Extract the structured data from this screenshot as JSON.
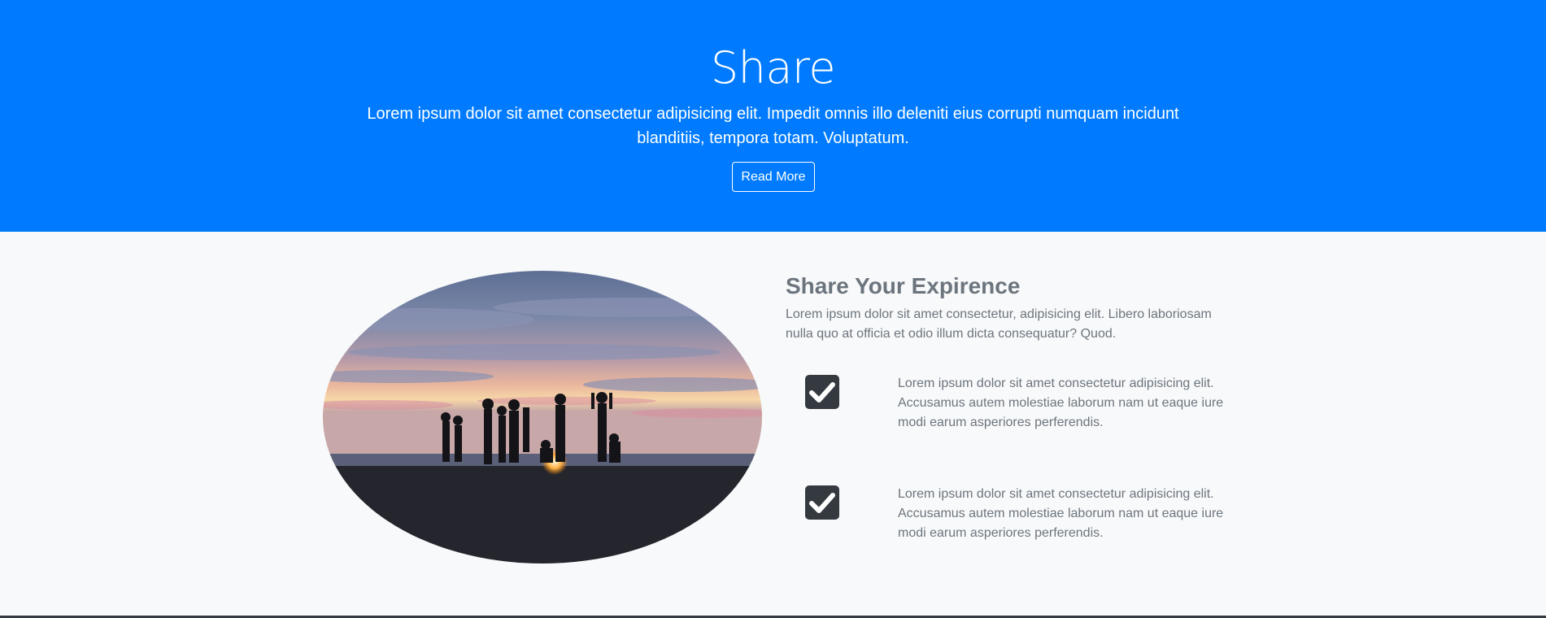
{
  "colors": {
    "hero_bg": "#007bff",
    "section_bg": "#f8f9fa",
    "check_bg": "#343a40"
  },
  "hero": {
    "title": "Share",
    "text": "Lorem ipsum dolor sit amet consectetur adipisicing elit. Impedit omnis illo deleniti eius corrupti numquam incidunt blanditiis, tempora totam. Voluptatum.",
    "button_label": "Read More"
  },
  "experience": {
    "heading": "Share Your Expirence",
    "text": "Lorem ipsum dolor sit amet consectetur, adipisicing elit. Libero laboriosam nulla quo at officia et odio illum dicta consequatur? Quod.",
    "features": [
      {
        "icon": "check-square-icon",
        "text": "Lorem ipsum dolor sit amet consectetur adipisicing elit. Accusamus autem molestiae laborum nam ut eaque iure modi earum asperiores perferendis."
      },
      {
        "icon": "check-square-icon",
        "text": "Lorem ipsum dolor sit amet consectetur adipisicing elit. Accusamus autem molestiae laborum nam ut eaque iure modi earum asperiores perferendis."
      }
    ]
  }
}
